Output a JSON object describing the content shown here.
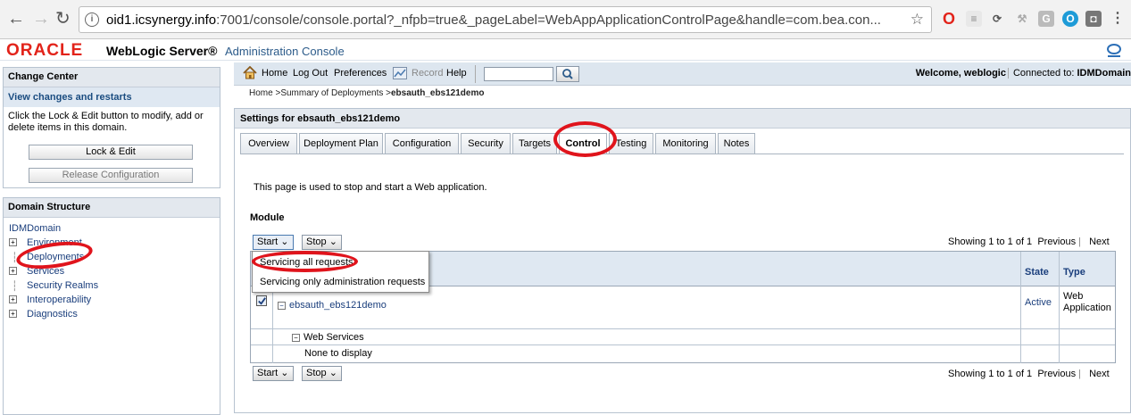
{
  "browser": {
    "url_host": "oid1.icsynergy.info",
    "url_rest": ":7001/console/console.portal?_nfpb=true&_pageLabel=WebAppApplicationControlPage&handle=com.bea.con..."
  },
  "header": {
    "oracle_logo": "ORACLE",
    "product": "WebLogic Server®",
    "console": "Administration Console"
  },
  "change_center": {
    "title": "Change Center",
    "subtitle": "View changes and restarts",
    "text": "Click the Lock & Edit button to modify, add or delete items in this domain.",
    "lock_button": "Lock & Edit",
    "release_button": "Release Configuration"
  },
  "domain_structure": {
    "title": "Domain Structure",
    "root": "IDMDomain",
    "items": [
      "Environment",
      "Deployments",
      "Services",
      "Security Realms",
      "Interoperability",
      "Diagnostics"
    ]
  },
  "toolbar": {
    "home": "Home",
    "logout": "Log Out",
    "preferences": "Preferences",
    "record": "Record",
    "help": "Help",
    "search_value": "",
    "welcome": "Welcome, weblogic",
    "connected": "Connected to: IDMDomain"
  },
  "breadcrumb": {
    "home": "Home",
    "summary": "Summary of Deployments",
    "current": "ebsauth_ebs121demo"
  },
  "settings": {
    "title": "Settings for ebsauth_ebs121demo",
    "tabs": [
      "Overview",
      "Deployment Plan",
      "Configuration",
      "Security",
      "Targets",
      "Control",
      "Testing",
      "Monitoring",
      "Notes"
    ],
    "active_tab": "Control",
    "description": "This page is used to stop and start a Web application.",
    "module_title": "Module"
  },
  "module_table": {
    "start_button": "Start",
    "stop_button": "Stop",
    "showing": "Showing 1 to 1 of 1",
    "previous": "Previous",
    "next": "Next",
    "columns": [
      "State",
      "Type"
    ],
    "app_name": "ebsauth_ebs121demo",
    "app_state": "Active",
    "app_type_line1": "Web",
    "app_type_line2": "Application",
    "web_services": "Web Services",
    "none": "None to display"
  },
  "start_menu": {
    "options": [
      "Servicing all requests",
      "Servicing only administration requests"
    ]
  }
}
